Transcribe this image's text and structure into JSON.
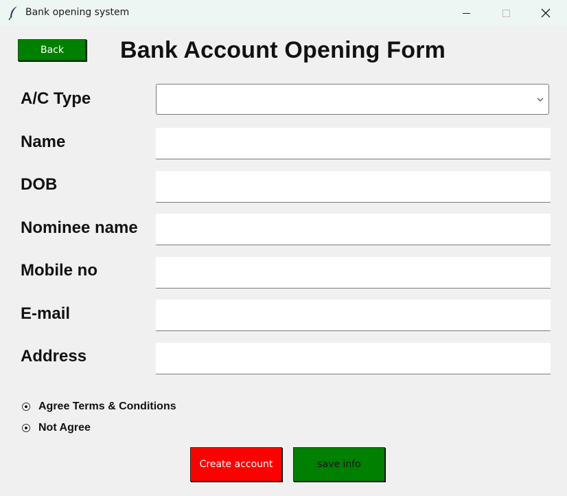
{
  "window": {
    "title": "Bank opening system",
    "icon": "feather-icon",
    "controls": [
      "minimize-icon",
      "maximize-icon",
      "close-icon"
    ]
  },
  "header": {
    "back_label": "Back",
    "title": "Bank Account Opening Form"
  },
  "form": {
    "ac_type": {
      "label": "A/C Type",
      "value": ""
    },
    "name": {
      "label": "Name",
      "value": ""
    },
    "dob": {
      "label": "DOB",
      "value": ""
    },
    "nominee": {
      "label": "Nominee name",
      "value": ""
    },
    "mobile": {
      "label": "Mobile no",
      "value": ""
    },
    "email": {
      "label": "E-mail",
      "value": ""
    },
    "address": {
      "label": "Address",
      "value": ""
    }
  },
  "terms": {
    "agree_label": "Agree Terms & Conditions",
    "disagree_label": "Not Agree"
  },
  "actions": {
    "create_label": "Create account",
    "save_label": "save info"
  },
  "colors": {
    "back_button": "#008000",
    "create_button": "#ff0000",
    "save_button": "#008000",
    "window_bg": "#f0f0f0"
  }
}
